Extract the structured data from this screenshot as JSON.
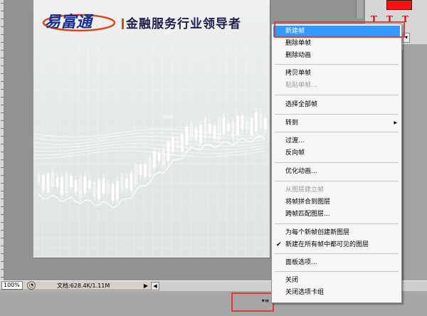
{
  "document": {
    "banner_text": "金融服务行业领导者",
    "logo_text": "易富通",
    "tag_sell": "sell",
    "tag_buy": "buy"
  },
  "status": {
    "zoom": "100%",
    "doc_info": "文档:628.4K/1.11M"
  },
  "menu": {
    "items": [
      {
        "label": "新建帧",
        "state": "selected"
      },
      {
        "label": "删除单帧",
        "state": "normal"
      },
      {
        "label": "删除动画",
        "state": "normal"
      },
      {
        "label": "拷贝单帧",
        "state": "normal"
      },
      {
        "label": "粘贴单帧...",
        "state": "disabled"
      },
      {
        "label": "选择全部帧",
        "state": "normal"
      },
      {
        "label": "转到",
        "state": "normal",
        "submenu": true
      },
      {
        "label": "过渡...",
        "state": "normal"
      },
      {
        "label": "反向帧",
        "state": "normal"
      },
      {
        "label": "优化动画...",
        "state": "normal"
      },
      {
        "label": "从图层建立帧",
        "state": "disabled"
      },
      {
        "label": "将帧拼合到图层",
        "state": "normal"
      },
      {
        "label": "跨帧匹配图层...",
        "state": "normal"
      },
      {
        "label": "为每个新帧创建新图层",
        "state": "normal"
      },
      {
        "label": "新建在所有帧中都可见的图层",
        "state": "normal",
        "checked": true
      },
      {
        "label": "面板选项...",
        "state": "normal"
      },
      {
        "label": "关闭",
        "state": "normal"
      },
      {
        "label": "关闭选项卡组",
        "state": "normal"
      }
    ]
  },
  "panel": {
    "swatch_color": "#ff1111",
    "type_glyph": "T"
  },
  "icons": {
    "submenu": "submenu-arrow-icon",
    "check": "checkmark-icon",
    "panel_menu": "panel-menu-icon"
  }
}
